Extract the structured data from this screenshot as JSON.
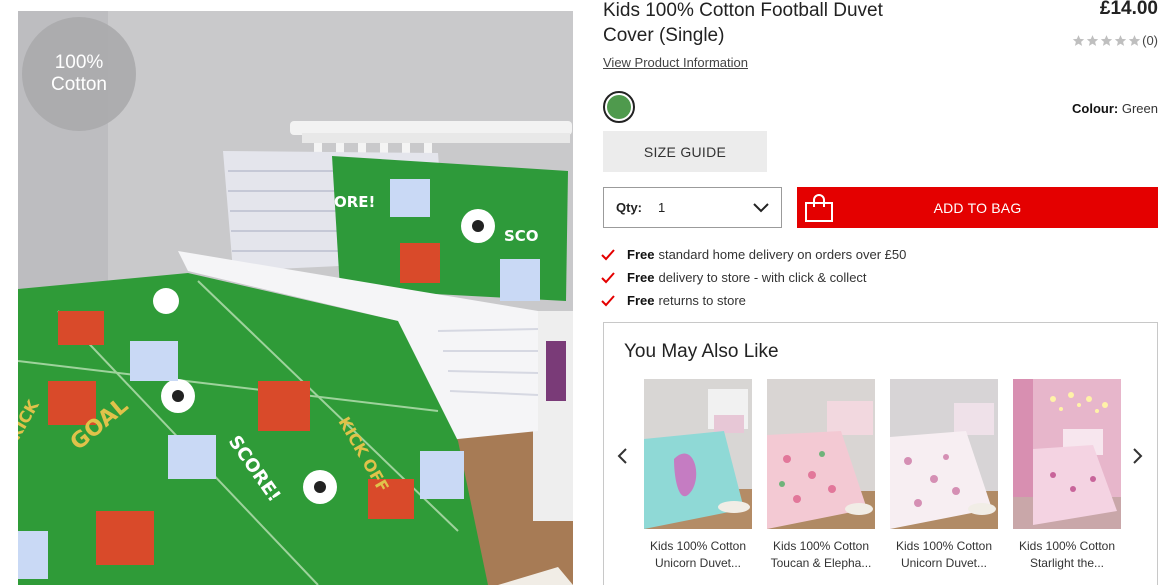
{
  "badge": {
    "line1": "100%",
    "line2": "Cotton"
  },
  "product": {
    "title": "Kids 100% Cotton Football Duvet Cover (Single)",
    "price": "£14.00",
    "rating_count": "(0)",
    "rating_value": 0,
    "rating_max": 5,
    "view_info": "View Product Information",
    "colour_label": "Colour:",
    "colour_value": "Green",
    "colour_hex": "#4f9a4d"
  },
  "size_guide_label": "SIZE GUIDE",
  "quantity": {
    "label": "Qty:",
    "value": "1"
  },
  "add_to_bag_label": "ADD TO BAG",
  "accent_color": "#e40000",
  "delivery": [
    {
      "bold": "Free",
      "text": "standard home delivery on orders over £50"
    },
    {
      "bold": "Free",
      "text": "delivery to store - with click & collect"
    },
    {
      "bold": "Free",
      "text": "returns to store"
    }
  ],
  "recommendations": {
    "title": "You May Also Like",
    "items": [
      {
        "line1": "Kids 100% Cotton",
        "line2": "Unicorn Duvet..."
      },
      {
        "line1": "Kids 100% Cotton",
        "line2": "Toucan & Elepha..."
      },
      {
        "line1": "Kids 100% Cotton",
        "line2": "Unicorn Duvet..."
      },
      {
        "line1": "Kids 100% Cotton",
        "line2": "Starlight the..."
      }
    ]
  },
  "icons": {
    "badge": "cotton-badge",
    "rating": "star-icon",
    "qty_dropdown": "chevron-down-icon",
    "add_to_bag": "shopping-bag-icon",
    "delivery": "check-icon",
    "carousel_prev": "chevron-left-icon",
    "carousel_next": "chevron-right-icon"
  }
}
